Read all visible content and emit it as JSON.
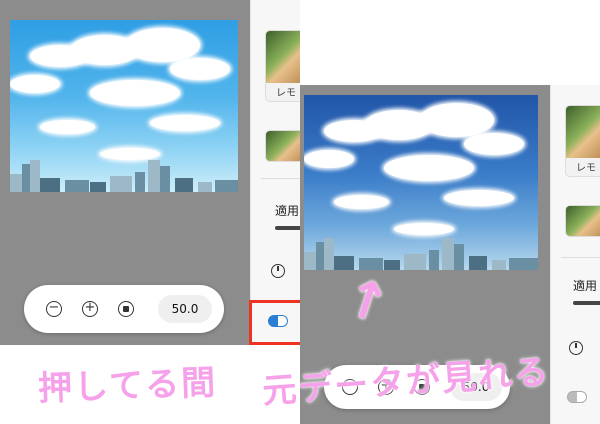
{
  "left_panel": {
    "thumbnail_label": "レモ",
    "apply_label": "適用",
    "zoom_value": "50.0"
  },
  "right_panel": {
    "thumbnail_label": "レモ",
    "apply_label": "適用",
    "zoom_value": "50.0"
  },
  "annotation": {
    "text_left": "押してる間",
    "text_right": "元データが見れる",
    "arrow": "↑"
  },
  "colors": {
    "highlight": "#ee3322",
    "annotation": "#f6a2ea",
    "compare_toggle": "#2a7fd4"
  }
}
